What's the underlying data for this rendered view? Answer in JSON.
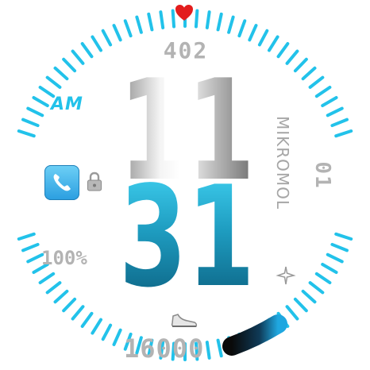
{
  "heart_rate": {
    "value": "402",
    "icon": "heart-icon",
    "color": "#e31d1d"
  },
  "time": {
    "hour": "11",
    "minute": "31",
    "ampm": "AM"
  },
  "date": {
    "day": "01",
    "brand": "MIKROMOL"
  },
  "battery": {
    "percent": "100%"
  },
  "steps": {
    "value": "16000",
    "icon": "shoe-icon",
    "goal_progress": 0.35
  },
  "shortcut": {
    "phone_icon": "phone-icon",
    "lock_icon": "lock-icon",
    "plane_icon": "airplane-icon"
  },
  "colors": {
    "accent": "#22c2ea",
    "silver": "#b3b3b3"
  }
}
